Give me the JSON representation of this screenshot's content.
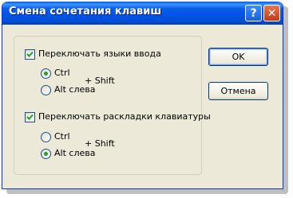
{
  "window": {
    "title": "Смена сочетания клавиш"
  },
  "group1": {
    "checkbox_label": "Переключать языки ввода",
    "checked": true,
    "option_ctrl": "Ctrl",
    "option_alt": "Alt слева",
    "selected": "Ctrl",
    "plus_shift": "+ Shift"
  },
  "group2": {
    "checkbox_label": "Переключать раскладки клавиатуры",
    "checked": true,
    "option_ctrl": "Ctrl",
    "option_alt": "Alt слева",
    "selected": "Alt слева",
    "plus_shift": "+ Shift"
  },
  "buttons": {
    "ok": "OK",
    "cancel": "Отмена"
  },
  "titlebar_buttons": {
    "help": "?",
    "close": "✕"
  },
  "colors": {
    "titlebar": "#0054e3",
    "face": "#ece9d8",
    "radio_dot": "#21a121",
    "check": "#21a121"
  }
}
